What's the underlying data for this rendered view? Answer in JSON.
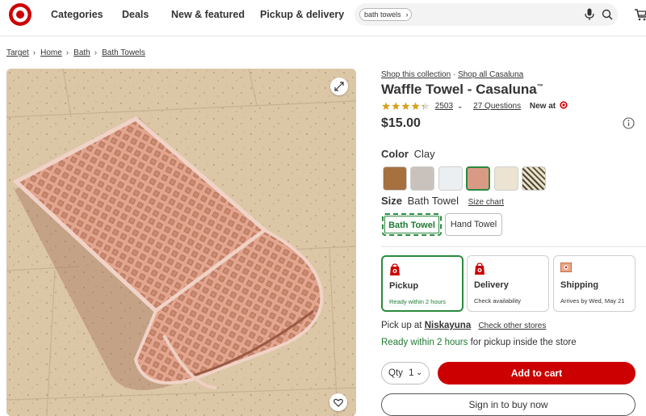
{
  "header": {
    "nav": [
      "Categories",
      "Deals",
      "New & featured",
      "Pickup & delivery"
    ],
    "search": {
      "chip": "bath towels"
    },
    "brand_color": "#cc0000"
  },
  "breadcrumb": [
    "Target",
    "Home",
    "Bath",
    "Bath Towels"
  ],
  "product": {
    "shop_collection": "Shop this collection",
    "separator": "·",
    "shop_brand": "Shop all Casaluna",
    "title": "Waffle Towel - Casaluna",
    "trademark": "™",
    "rating": 4.3,
    "review_count": "2503",
    "questions": "27 Questions",
    "new_at": "New at",
    "price": "$15.00",
    "color_label": "Color",
    "color_value": "Clay",
    "swatches": [
      {
        "name": "brown",
        "color": "#a6703f",
        "selected": false
      },
      {
        "name": "gray",
        "color": "#c9c2bc",
        "selected": false
      },
      {
        "name": "white",
        "color": "#eceff2",
        "selected": false
      },
      {
        "name": "clay",
        "color": "#d99a85",
        "selected": true
      },
      {
        "name": "cream",
        "color": "#ede3d2",
        "selected": false
      },
      {
        "name": "pattern",
        "color": "#6b6148",
        "selected": false
      }
    ],
    "size_label": "Size",
    "size_value": "Bath Towel",
    "size_chart": "Size chart",
    "sizes": [
      "Bath Towel",
      "Hand Towel"
    ],
    "fulfillment": [
      {
        "title": "Pickup",
        "sub": "Ready within 2 hours"
      },
      {
        "title": "Delivery",
        "sub": "Check availability"
      },
      {
        "title": "Shipping",
        "sub": "Arrives by Wed, May 21"
      }
    ],
    "pickup_prefix": "Pick up at",
    "store": "Niskayuna",
    "check_other": "Check other stores",
    "ready_green": "Ready within 2 hours",
    "ready_rest": "for pickup inside the store",
    "qty_label": "Qty",
    "qty_value": "1",
    "add_to_cart": "Add to cart",
    "sign_in": "Sign in to buy now"
  },
  "icons": [
    "target-logo",
    "mic-icon",
    "search-icon",
    "cart-icon",
    "expand-icon",
    "heart-icon",
    "info-icon",
    "store-icon",
    "truck-icon",
    "box-icon",
    "chevron-down-icon"
  ]
}
